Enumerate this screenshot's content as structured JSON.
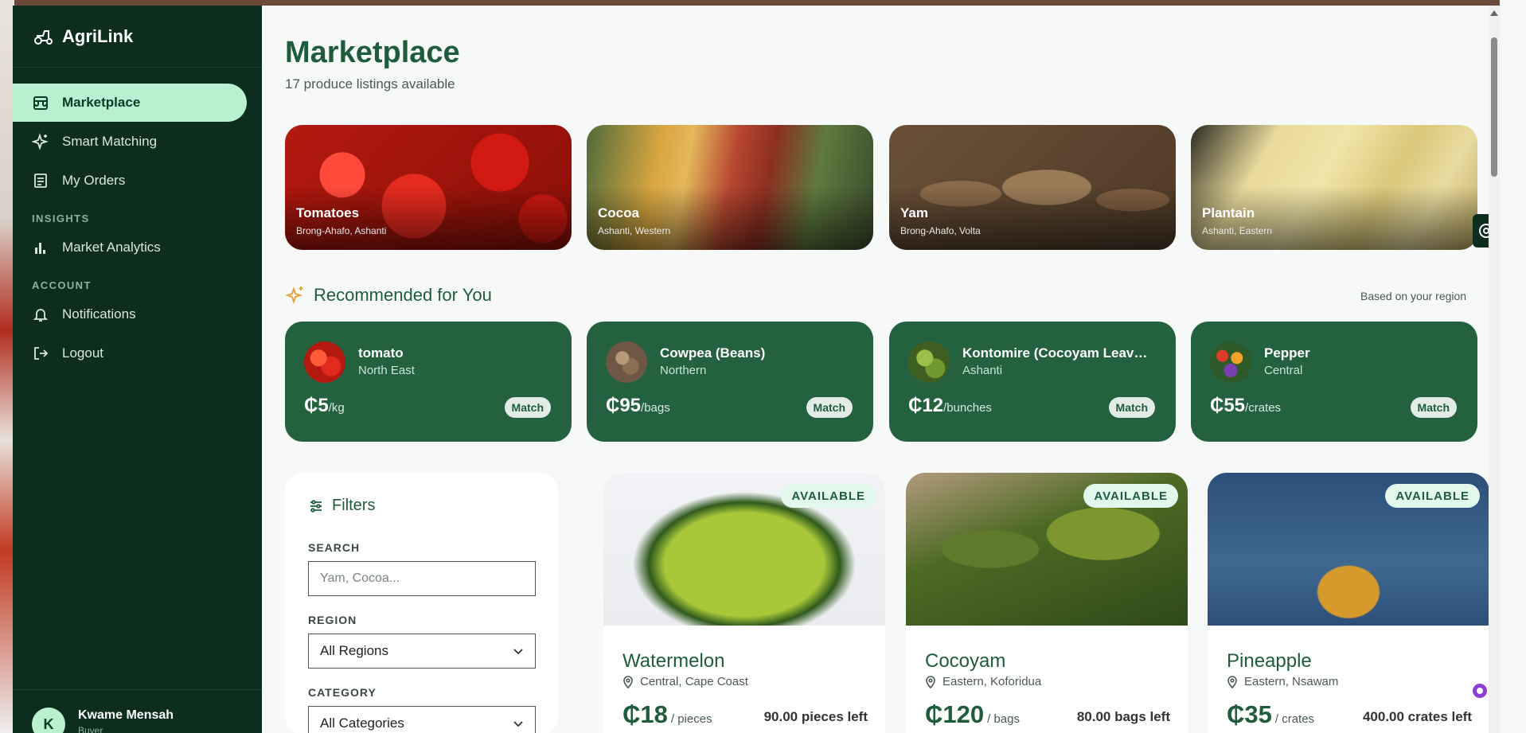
{
  "app": {
    "name": "AgriLink"
  },
  "sidebar": {
    "items": [
      {
        "label": "Marketplace",
        "icon": "store-icon",
        "active": true
      },
      {
        "label": "Smart Matching",
        "icon": "sparkle-icon"
      },
      {
        "label": "My Orders",
        "icon": "receipt-icon"
      }
    ],
    "insights_label": "INSIGHTS",
    "insights_items": [
      {
        "label": "Market Analytics",
        "icon": "bar-chart-icon"
      }
    ],
    "account_label": "ACCOUNT",
    "account_items": [
      {
        "label": "Notifications",
        "icon": "bell-icon"
      },
      {
        "label": "Logout",
        "icon": "logout-icon"
      }
    ],
    "user": {
      "initial": "K",
      "name": "Kwame Mensah",
      "role": "Buyer"
    }
  },
  "main": {
    "title": "Marketplace",
    "subtitle": "17 produce listings available",
    "heroes": [
      {
        "name": "Tomatoes",
        "region": "Brong-Ahafo, Ashanti"
      },
      {
        "name": "Cocoa",
        "region": "Ashanti, Western"
      },
      {
        "name": "Yam",
        "region": "Brong-Ahafo, Volta"
      },
      {
        "name": "Plantain",
        "region": "Ashanti, Eastern"
      }
    ],
    "recommended": {
      "title": "Recommended for You",
      "note": "Based on your region",
      "items": [
        {
          "name": "tomato",
          "region": "North East",
          "price": "₵5",
          "unit": "/kg",
          "action": "Match"
        },
        {
          "name": "Cowpea (Beans)",
          "region": "Northern",
          "price": "₵95",
          "unit": "/bags",
          "action": "Match"
        },
        {
          "name": "Kontomire (Cocoyam Leav…",
          "region": "Ashanti",
          "price": "₵12",
          "unit": "/bunches",
          "action": "Match"
        },
        {
          "name": "Pepper",
          "region": "Central",
          "price": "₵55",
          "unit": "/crates",
          "action": "Match"
        }
      ]
    },
    "filters": {
      "title": "Filters",
      "search_label": "SEARCH",
      "search_placeholder": "Yam, Cocoa...",
      "region_label": "REGION",
      "region_value": "All Regions",
      "category_label": "CATEGORY",
      "category_value": "All Categories"
    },
    "listings": [
      {
        "badge": "AVAILABLE",
        "name": "Watermelon",
        "location": "Central, Cape Coast",
        "price": "₵18",
        "unit": "/ pieces",
        "left": "90.00 pieces left"
      },
      {
        "badge": "AVAILABLE",
        "name": "Cocoyam",
        "location": "Eastern, Koforidua",
        "price": "₵120",
        "unit": "/ bags",
        "left": "80.00 bags left"
      },
      {
        "badge": "AVAILABLE",
        "name": "Pineapple",
        "location": "Eastern, Nsawam",
        "price": "₵35",
        "unit": "/ crates",
        "left": "400.00 crates left"
      }
    ]
  },
  "colors": {
    "sidebar_bg": "#0d2d1f",
    "accent": "#1f5c3c",
    "active_item": "#b9f0cf",
    "rec_card": "#24613f"
  }
}
